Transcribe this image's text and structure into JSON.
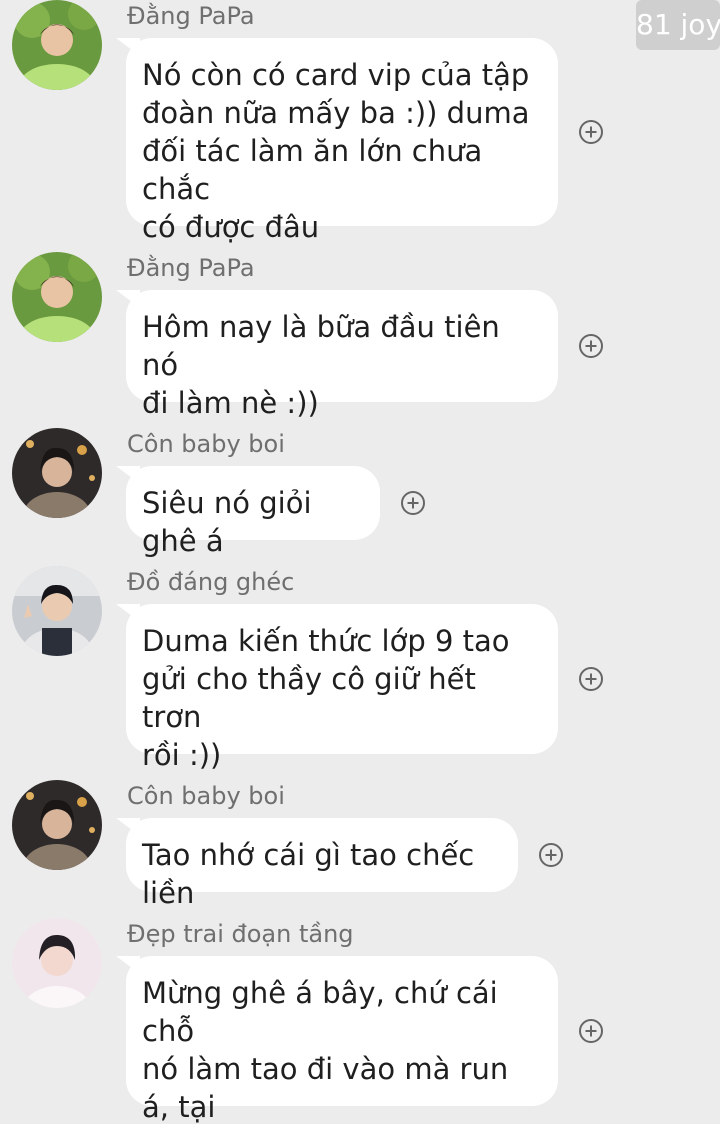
{
  "watermark": "81 joy",
  "messages": [
    {
      "sender": "Đằng PaPa",
      "avatar": "avatar-dang-papa",
      "text": "Nó còn có card vip của tập\nđoàn nữa mấy ba :)) duma\nđối tác làm ăn lớn chưa chắc\ncó được đâu",
      "react_icon": "add-reaction-icon"
    },
    {
      "sender": "Đằng PaPa",
      "avatar": "avatar-dang-papa",
      "text": "Hôm nay là bữa đầu tiên nó\nđi làm nè :))",
      "react_icon": "add-reaction-icon"
    },
    {
      "sender": "Côn baby boi",
      "avatar": "avatar-con-baby-boi",
      "text": "Siêu nó giỏi ghê á",
      "react_icon": "add-reaction-icon"
    },
    {
      "sender": "Đồ đáng ghéc",
      "avatar": "avatar-do-dang-ghec",
      "text": "Duma kiến thức lớp 9 tao\ngửi cho thầy cô giữ hết trơn\nrồi :))",
      "react_icon": "add-reaction-icon"
    },
    {
      "sender": "Côn baby boi",
      "avatar": "avatar-con-baby-boi",
      "text": "Tao nhớ cái gì tao chếc liền",
      "react_icon": "add-reaction-icon"
    },
    {
      "sender": "Đẹp trai đoạn tầng",
      "avatar": "avatar-dep-trai-doan-tang",
      "text": "Mừng ghê á bây, chứ cái chỗ\nnó làm tao đi vào mà run á, tại\nnhìn hơi tàn",
      "react_icon": "add-reaction-icon"
    }
  ]
}
